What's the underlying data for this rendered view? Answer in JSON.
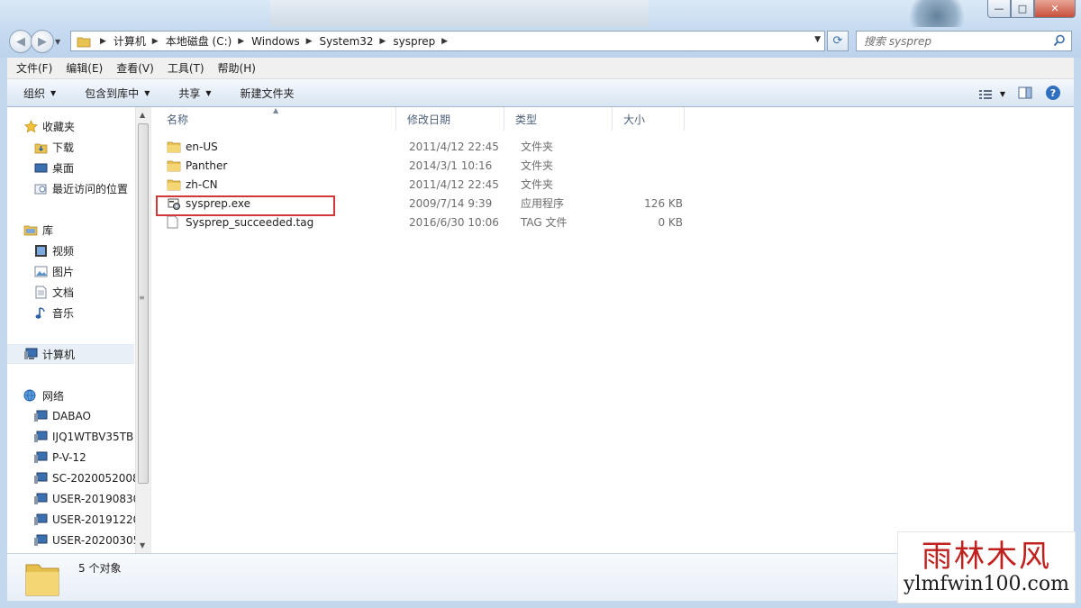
{
  "window": {
    "buttons": {
      "minimize": "—",
      "maximize": "□",
      "close": "✕"
    }
  },
  "address": {
    "crumbs": [
      "计算机",
      "本地磁盘 (C:)",
      "Windows",
      "System32",
      "sysprep"
    ]
  },
  "search": {
    "placeholder": "搜索 sysprep"
  },
  "menu": [
    "文件(F)",
    "编辑(E)",
    "查看(V)",
    "工具(T)",
    "帮助(H)"
  ],
  "toolbar": {
    "organize": "组织",
    "include_in_library": "包含到库中",
    "share": "共享",
    "new_folder": "新建文件夹"
  },
  "nav": {
    "favorites": "收藏夹",
    "downloads": "下载",
    "desktop": "桌面",
    "recent": "最近访问的位置",
    "libraries": "库",
    "videos": "视频",
    "pictures": "图片",
    "documents": "文档",
    "music": "音乐",
    "computer": "计算机",
    "network": "网络",
    "hosts": [
      "DABAO",
      "IJQ1WTBV35TB",
      "P-V-12",
      "SC-2020052008",
      "USER-20190830",
      "USER-20191220",
      "USER-20200305"
    ]
  },
  "columns": {
    "name": "名称",
    "date": "修改日期",
    "type": "类型",
    "size": "大小"
  },
  "files": [
    {
      "name": "en-US",
      "date": "2011/4/12 22:45",
      "type": "文件夹",
      "size": ""
    },
    {
      "name": "Panther",
      "date": "2014/3/1 10:16",
      "type": "文件夹",
      "size": ""
    },
    {
      "name": "zh-CN",
      "date": "2011/4/12 22:45",
      "type": "文件夹",
      "size": ""
    },
    {
      "name": "sysprep.exe",
      "date": "2009/7/14 9:39",
      "type": "应用程序",
      "size": "126 KB"
    },
    {
      "name": "Sysprep_succeeded.tag",
      "date": "2016/6/30 10:06",
      "type": "TAG 文件",
      "size": "0 KB"
    }
  ],
  "status": {
    "count": "5 个对象"
  },
  "watermark": {
    "cn": "雨林木风",
    "en": "ylmfwin100.com"
  },
  "colors": {
    "highlight": "#d0383a",
    "watermark_red": "#c0201e"
  }
}
